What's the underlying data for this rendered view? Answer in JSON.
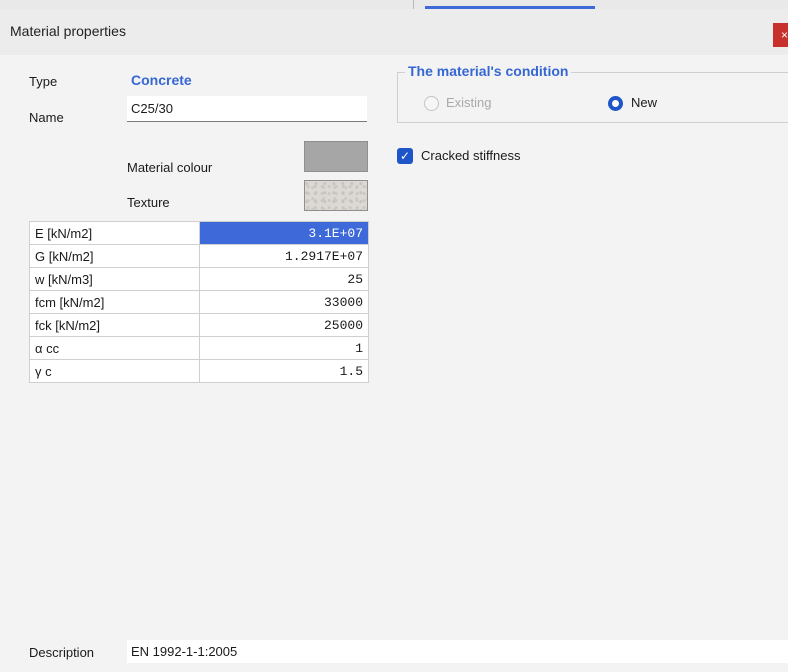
{
  "window": {
    "title": "Material properties",
    "close_glyph": "×"
  },
  "labels": {
    "type": "Type",
    "name": "Name",
    "material_colour": "Material colour",
    "texture": "Texture",
    "description": "Description"
  },
  "type_value": "Concrete",
  "name_value": "C25/30",
  "material_colour_hex": "#a6a6a6",
  "properties": [
    {
      "name": "E [kN/m2]",
      "value": "3.1E+07"
    },
    {
      "name": "G [kN/m2]",
      "value": "1.2917E+07"
    },
    {
      "name": "w [kN/m3]",
      "value": "25"
    },
    {
      "name": "fcm [kN/m2]",
      "value": "33000"
    },
    {
      "name": "fck [kN/m2]",
      "value": "25000"
    },
    {
      "name": "α cc",
      "value": "1"
    },
    {
      "name": "γ c",
      "value": "1.5"
    }
  ],
  "condition": {
    "title": "The material's condition",
    "options": [
      {
        "label": "Existing",
        "selected": false,
        "enabled": false
      },
      {
        "label": "New",
        "selected": true,
        "enabled": true
      }
    ]
  },
  "cracked_stiffness": {
    "label": "Cracked stiffness",
    "checked": true
  },
  "description_value": "EN 1992-1-1:2005",
  "colors": {
    "accent": "#3567d3",
    "selection": "#3d6ad8",
    "close": "#c8312b"
  }
}
